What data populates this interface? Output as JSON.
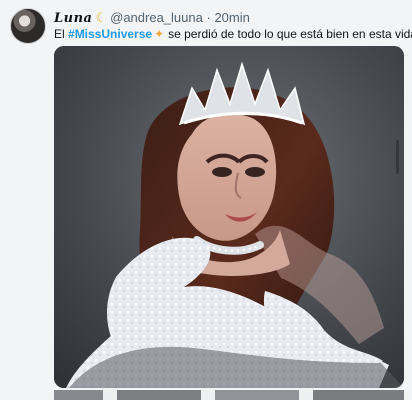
{
  "tweet": {
    "display_name": "Luna",
    "display_name_emoji": "☾",
    "handle": "@andrea_luuna",
    "separator": "·",
    "time": "20min",
    "text_prefix": "El",
    "hashtag": "#MissUniverse",
    "sparkle_emoji": "✦",
    "text_suffix": "se perdió de todo lo que está bien en esta vida",
    "heart_emoji": "♥"
  },
  "media": {
    "description_icon": "portrait-image"
  },
  "colors": {
    "hashtag": "#1d9bf0",
    "metadata": "#536471",
    "background": "#f3f4f5"
  }
}
